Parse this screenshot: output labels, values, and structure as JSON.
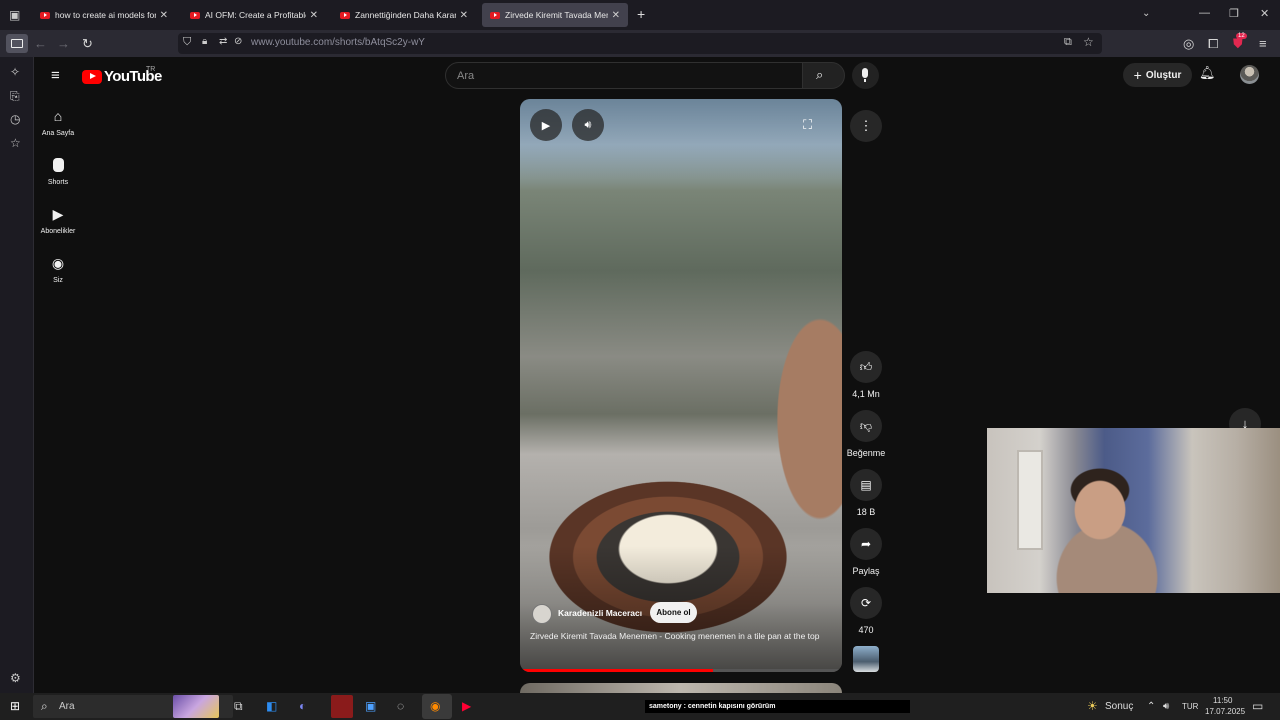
{
  "browser": {
    "tabs": [
      {
        "title": "how to create ai models for onl"
      },
      {
        "title": "AI OFM: Create a Profitable AI I"
      },
      {
        "title": "Zannettiğinden Daha Karanlıks"
      },
      {
        "title": "Zirvede Kiremit Tavada Menem"
      }
    ],
    "new_tab": "+",
    "url": "www.youtube.com/shorts/bAtqSc2y-wY",
    "extensions_badge": "12"
  },
  "youtube": {
    "logo_text": "YouTube",
    "region": "TR",
    "search_placeholder": "Ara",
    "create_label": "Oluştur",
    "nav": [
      {
        "label": "Ana Sayfa",
        "icon": "home-icon"
      },
      {
        "label": "Shorts",
        "icon": "shorts-icon"
      },
      {
        "label": "Abonelikler",
        "icon": "subscriptions-icon"
      },
      {
        "label": "Siz",
        "icon": "account-icon"
      }
    ],
    "short": {
      "channel": "Karadenizli Maceracı",
      "subscribe_label": "Abone ol",
      "title": "Zirvede Kiremit Tavada Menemen - Cooking menemen in a tile pan at the top",
      "progress": 0.6
    },
    "actions": {
      "like_count": "4,1 Mn",
      "dislike_label": "Beğenme",
      "comment_count": "18 B",
      "share_label": "Paylaş",
      "remix_count": "470"
    }
  },
  "taskbar": {
    "search_placeholder": "Ara",
    "notification": "sametony : cennetin kapısını görürüm",
    "weather": "Sonuç",
    "language": "TUR",
    "time": "11:50",
    "date": "17.07.2025"
  },
  "colors": {
    "youtube_red": "#ff0000",
    "background": "#0f0f0f",
    "firefox_chrome": "#2b2a33"
  }
}
